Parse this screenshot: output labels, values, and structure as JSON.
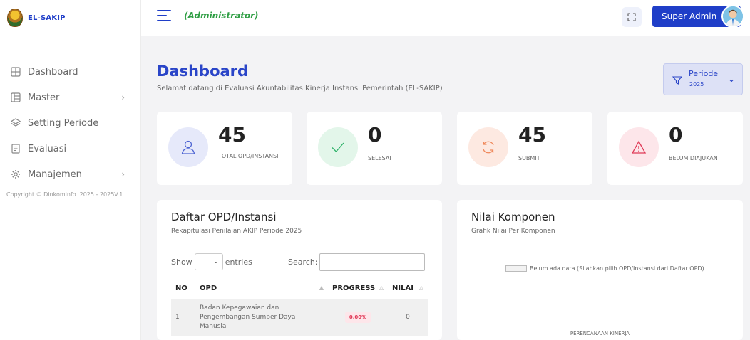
{
  "brand": {
    "name": "EL-SAKIP"
  },
  "topbar": {
    "role": "(Administrator)",
    "user_label": "Super Admin"
  },
  "sidebar": {
    "items": [
      {
        "label": "Dashboard",
        "icon": "dashboard-icon",
        "has_submenu": false
      },
      {
        "label": "Master",
        "icon": "master-icon",
        "has_submenu": true
      },
      {
        "label": "Setting Periode",
        "icon": "layers-icon",
        "has_submenu": false
      },
      {
        "label": "Evaluasi",
        "icon": "evaluation-icon",
        "has_submenu": false
      },
      {
        "label": "Manajemen",
        "icon": "gear-icon",
        "has_submenu": true
      }
    ],
    "copyright": "Copyright © Dinkominfo. 2025 - 2025V.1"
  },
  "header": {
    "title": "Dashboard",
    "subtitle": "Selamat datang di Evaluasi Akuntabilitas Kinerja Instansi Pemerintah (EL-SAKIP)",
    "periode_label": "Periode",
    "periode_year": "2025"
  },
  "stats": [
    {
      "value": "45",
      "label": "TOTAL OPD/INSTANSI",
      "color": "#4c63d2",
      "bg": "#e6e9fa",
      "icon": "user-icon"
    },
    {
      "value": "0",
      "label": "SELESAI",
      "color": "#2fb36a",
      "bg": "#e3f6ea",
      "icon": "check-icon"
    },
    {
      "value": "45",
      "label": "SUBMIT",
      "color": "#f08a5d",
      "bg": "#fde9e1",
      "icon": "refresh-icon"
    },
    {
      "value": "0",
      "label": "BELUM DIAJUKAN",
      "color": "#e03a57",
      "bg": "#fde6ea",
      "icon": "warning-icon"
    }
  ],
  "opd_panel": {
    "title": "Daftar OPD/Instansi",
    "subtitle": "Rekapitulasi Penilaian AKIP Periode 2025",
    "show_label": "Show",
    "entries_label": "entries",
    "search_label": "Search:",
    "columns": [
      "NO",
      "OPD",
      "PROGRESS",
      "NILAI"
    ],
    "rows": [
      {
        "no": "1",
        "opd": "Badan Kepegawaian dan Pengembangan Sumber Daya Manusia",
        "progress": "0.00%",
        "nilai": "0"
      }
    ]
  },
  "komponen_panel": {
    "title": "Nilai Komponen",
    "subtitle": "Grafik Nilai Per Komponen",
    "legend": "Belum ada data (Silahkan pilih OPD/Instansi dari Daftar OPD)",
    "axis_label": "PERENCANAAN KINERJA"
  }
}
